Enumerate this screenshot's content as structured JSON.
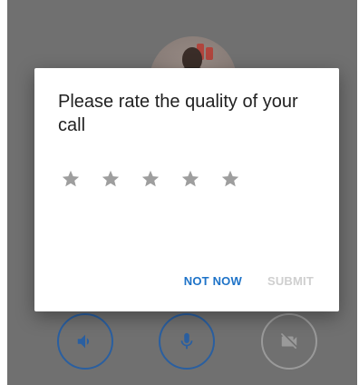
{
  "dialog": {
    "title": "Please rate the quality of your call",
    "rating": {
      "value": 0,
      "max": 5
    },
    "buttons": {
      "not_now": "NOT NOW",
      "submit": "SUBMIT"
    }
  },
  "call_controls": {
    "speaker_icon": "speaker-icon",
    "mic_icon": "microphone-icon",
    "video_icon": "video-off-icon"
  },
  "colors": {
    "accent": "#1e73c8",
    "disabled": "#cfcfcf",
    "star_empty": "#9e9e9e",
    "scrim": "#707070"
  }
}
